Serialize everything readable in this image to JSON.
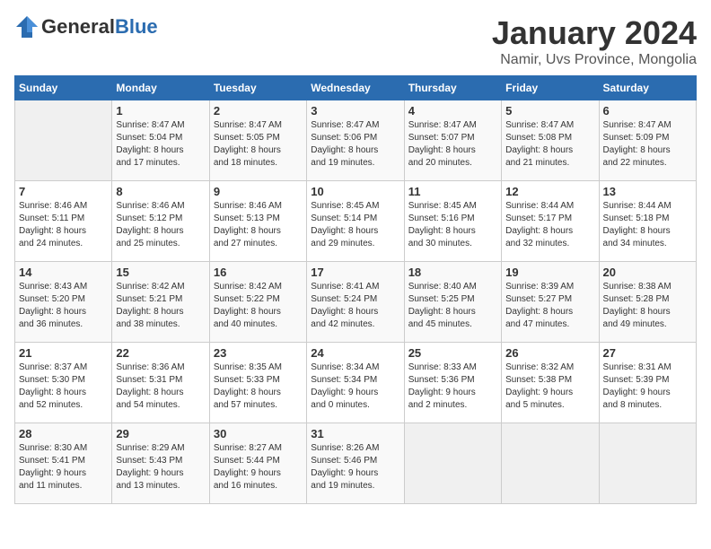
{
  "header": {
    "logo_general": "General",
    "logo_blue": "Blue",
    "month": "January 2024",
    "location": "Namir, Uvs Province, Mongolia"
  },
  "weekdays": [
    "Sunday",
    "Monday",
    "Tuesday",
    "Wednesday",
    "Thursday",
    "Friday",
    "Saturday"
  ],
  "weeks": [
    [
      {
        "day": "",
        "info": ""
      },
      {
        "day": "1",
        "info": "Sunrise: 8:47 AM\nSunset: 5:04 PM\nDaylight: 8 hours\nand 17 minutes."
      },
      {
        "day": "2",
        "info": "Sunrise: 8:47 AM\nSunset: 5:05 PM\nDaylight: 8 hours\nand 18 minutes."
      },
      {
        "day": "3",
        "info": "Sunrise: 8:47 AM\nSunset: 5:06 PM\nDaylight: 8 hours\nand 19 minutes."
      },
      {
        "day": "4",
        "info": "Sunrise: 8:47 AM\nSunset: 5:07 PM\nDaylight: 8 hours\nand 20 minutes."
      },
      {
        "day": "5",
        "info": "Sunrise: 8:47 AM\nSunset: 5:08 PM\nDaylight: 8 hours\nand 21 minutes."
      },
      {
        "day": "6",
        "info": "Sunrise: 8:47 AM\nSunset: 5:09 PM\nDaylight: 8 hours\nand 22 minutes."
      }
    ],
    [
      {
        "day": "7",
        "info": "Sunrise: 8:46 AM\nSunset: 5:11 PM\nDaylight: 8 hours\nand 24 minutes."
      },
      {
        "day": "8",
        "info": "Sunrise: 8:46 AM\nSunset: 5:12 PM\nDaylight: 8 hours\nand 25 minutes."
      },
      {
        "day": "9",
        "info": "Sunrise: 8:46 AM\nSunset: 5:13 PM\nDaylight: 8 hours\nand 27 minutes."
      },
      {
        "day": "10",
        "info": "Sunrise: 8:45 AM\nSunset: 5:14 PM\nDaylight: 8 hours\nand 29 minutes."
      },
      {
        "day": "11",
        "info": "Sunrise: 8:45 AM\nSunset: 5:16 PM\nDaylight: 8 hours\nand 30 minutes."
      },
      {
        "day": "12",
        "info": "Sunrise: 8:44 AM\nSunset: 5:17 PM\nDaylight: 8 hours\nand 32 minutes."
      },
      {
        "day": "13",
        "info": "Sunrise: 8:44 AM\nSunset: 5:18 PM\nDaylight: 8 hours\nand 34 minutes."
      }
    ],
    [
      {
        "day": "14",
        "info": "Sunrise: 8:43 AM\nSunset: 5:20 PM\nDaylight: 8 hours\nand 36 minutes."
      },
      {
        "day": "15",
        "info": "Sunrise: 8:42 AM\nSunset: 5:21 PM\nDaylight: 8 hours\nand 38 minutes."
      },
      {
        "day": "16",
        "info": "Sunrise: 8:42 AM\nSunset: 5:22 PM\nDaylight: 8 hours\nand 40 minutes."
      },
      {
        "day": "17",
        "info": "Sunrise: 8:41 AM\nSunset: 5:24 PM\nDaylight: 8 hours\nand 42 minutes."
      },
      {
        "day": "18",
        "info": "Sunrise: 8:40 AM\nSunset: 5:25 PM\nDaylight: 8 hours\nand 45 minutes."
      },
      {
        "day": "19",
        "info": "Sunrise: 8:39 AM\nSunset: 5:27 PM\nDaylight: 8 hours\nand 47 minutes."
      },
      {
        "day": "20",
        "info": "Sunrise: 8:38 AM\nSunset: 5:28 PM\nDaylight: 8 hours\nand 49 minutes."
      }
    ],
    [
      {
        "day": "21",
        "info": "Sunrise: 8:37 AM\nSunset: 5:30 PM\nDaylight: 8 hours\nand 52 minutes."
      },
      {
        "day": "22",
        "info": "Sunrise: 8:36 AM\nSunset: 5:31 PM\nDaylight: 8 hours\nand 54 minutes."
      },
      {
        "day": "23",
        "info": "Sunrise: 8:35 AM\nSunset: 5:33 PM\nDaylight: 8 hours\nand 57 minutes."
      },
      {
        "day": "24",
        "info": "Sunrise: 8:34 AM\nSunset: 5:34 PM\nDaylight: 9 hours\nand 0 minutes."
      },
      {
        "day": "25",
        "info": "Sunrise: 8:33 AM\nSunset: 5:36 PM\nDaylight: 9 hours\nand 2 minutes."
      },
      {
        "day": "26",
        "info": "Sunrise: 8:32 AM\nSunset: 5:38 PM\nDaylight: 9 hours\nand 5 minutes."
      },
      {
        "day": "27",
        "info": "Sunrise: 8:31 AM\nSunset: 5:39 PM\nDaylight: 9 hours\nand 8 minutes."
      }
    ],
    [
      {
        "day": "28",
        "info": "Sunrise: 8:30 AM\nSunset: 5:41 PM\nDaylight: 9 hours\nand 11 minutes."
      },
      {
        "day": "29",
        "info": "Sunrise: 8:29 AM\nSunset: 5:43 PM\nDaylight: 9 hours\nand 13 minutes."
      },
      {
        "day": "30",
        "info": "Sunrise: 8:27 AM\nSunset: 5:44 PM\nDaylight: 9 hours\nand 16 minutes."
      },
      {
        "day": "31",
        "info": "Sunrise: 8:26 AM\nSunset: 5:46 PM\nDaylight: 9 hours\nand 19 minutes."
      },
      {
        "day": "",
        "info": ""
      },
      {
        "day": "",
        "info": ""
      },
      {
        "day": "",
        "info": ""
      }
    ]
  ]
}
